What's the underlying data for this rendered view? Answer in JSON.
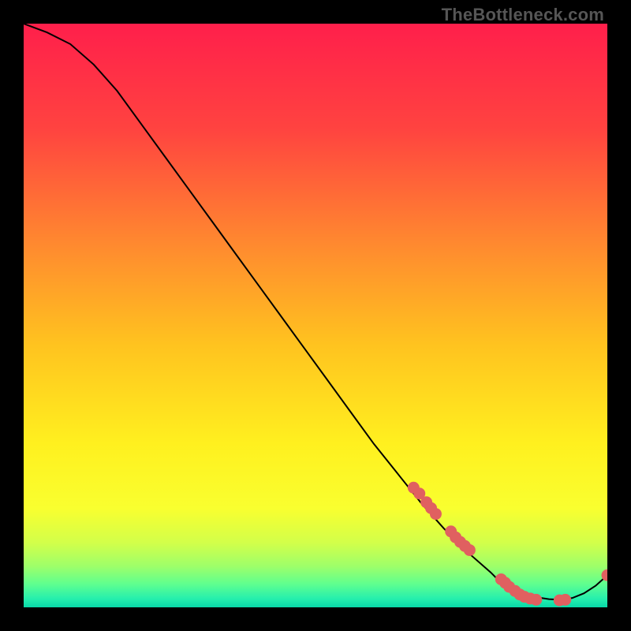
{
  "watermark": "TheBottleneck.com",
  "chart_data": {
    "type": "line",
    "title": "",
    "xlabel": "",
    "ylabel": "",
    "xlim": [
      0,
      100
    ],
    "ylim": [
      0,
      100
    ],
    "grid": false,
    "series": [
      {
        "name": "curve",
        "stroke": "#000000",
        "x": [
          0,
          4,
          8,
          12,
          16,
          20,
          24,
          28,
          32,
          36,
          40,
          44,
          48,
          52,
          56,
          60,
          64,
          68,
          72,
          76,
          80,
          81,
          82,
          83,
          84,
          86,
          88,
          90,
          92,
          94,
          96,
          98,
          100
        ],
        "y": [
          100,
          98.5,
          96.5,
          93,
          88.5,
          83,
          77.5,
          72,
          66.5,
          61,
          55.5,
          50,
          44.5,
          39,
          33.5,
          28,
          23,
          18,
          13.5,
          9.5,
          6,
          5,
          4.2,
          3.5,
          3,
          2.2,
          1.7,
          1.4,
          1.3,
          1.6,
          2.4,
          3.7,
          5.5
        ]
      }
    ],
    "markers": [
      {
        "x": 66.8,
        "y": 20.5
      },
      {
        "x": 67.8,
        "y": 19.5
      },
      {
        "x": 69.0,
        "y": 18.0
      },
      {
        "x": 69.8,
        "y": 17.0
      },
      {
        "x": 70.6,
        "y": 16.0
      },
      {
        "x": 73.2,
        "y": 13.0
      },
      {
        "x": 74.0,
        "y": 12.0
      },
      {
        "x": 74.8,
        "y": 11.2
      },
      {
        "x": 75.6,
        "y": 10.5
      },
      {
        "x": 76.4,
        "y": 9.8
      },
      {
        "x": 81.8,
        "y": 4.8
      },
      {
        "x": 82.5,
        "y": 4.2
      },
      {
        "x": 83.2,
        "y": 3.5
      },
      {
        "x": 84.2,
        "y": 2.8
      },
      {
        "x": 85.0,
        "y": 2.2
      },
      {
        "x": 85.8,
        "y": 1.8
      },
      {
        "x": 86.8,
        "y": 1.5
      },
      {
        "x": 87.8,
        "y": 1.3
      },
      {
        "x": 91.8,
        "y": 1.2
      },
      {
        "x": 92.8,
        "y": 1.3
      },
      {
        "x": 100.0,
        "y": 5.5
      }
    ],
    "gradient_stops": [
      {
        "offset": 0.0,
        "color": "#ff1f4b"
      },
      {
        "offset": 0.18,
        "color": "#ff4340"
      },
      {
        "offset": 0.38,
        "color": "#ff8a2f"
      },
      {
        "offset": 0.55,
        "color": "#ffc31f"
      },
      {
        "offset": 0.72,
        "color": "#fff01f"
      },
      {
        "offset": 0.83,
        "color": "#f9ff2f"
      },
      {
        "offset": 0.89,
        "color": "#d2ff4a"
      },
      {
        "offset": 0.93,
        "color": "#9dff6a"
      },
      {
        "offset": 0.96,
        "color": "#5fff8f"
      },
      {
        "offset": 0.985,
        "color": "#26efad"
      },
      {
        "offset": 1.0,
        "color": "#08d8a8"
      }
    ],
    "marker_style": {
      "fill": "#e06060",
      "r": 7.5
    }
  }
}
